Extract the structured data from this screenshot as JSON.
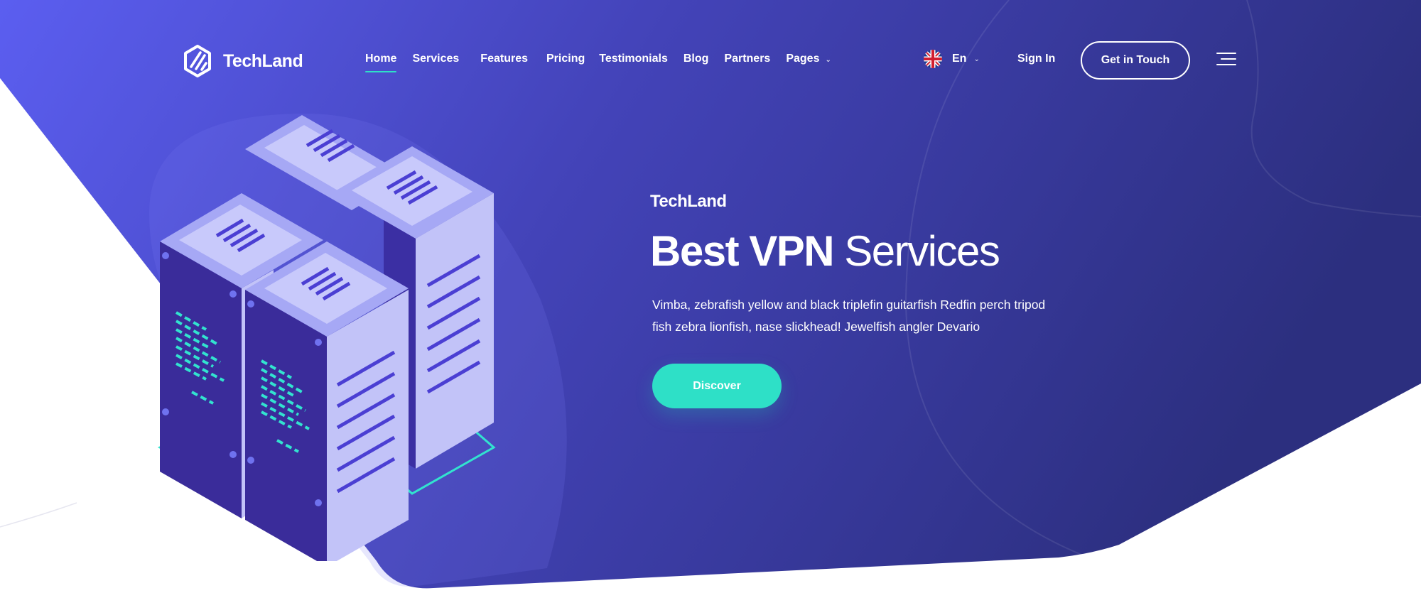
{
  "brand": {
    "name": "TechLand"
  },
  "nav": {
    "items": [
      {
        "label": "Home",
        "active": true
      },
      {
        "label": "Services"
      },
      {
        "label": "Features"
      },
      {
        "label": "Pricing"
      },
      {
        "label": "Testimonials"
      },
      {
        "label": "Blog"
      },
      {
        "label": "Partners"
      },
      {
        "label": "Pages",
        "dropdown": true
      }
    ],
    "language": {
      "label": "En",
      "icon": "uk-flag-icon"
    },
    "sign_in": "Sign In",
    "get_in_touch": "Get in Touch",
    "menu_icon": "hamburger-icon"
  },
  "hero": {
    "eyebrow": "TechLand",
    "title_strong": "Best VPN",
    "title_light": "Services",
    "description": "Vimba, zebrafish yellow and black triplefin guitarfish Redfin perch tripod fish zebra lionfish, nase slickhead! Jewelfish angler Devario",
    "cta": "Discover",
    "illustration": "isometric-server-racks-icon"
  },
  "colors": {
    "gradient_start": "#5b5ef0",
    "gradient_end": "#2c2f7f",
    "accent": "#2ee0c7",
    "text": "#ffffff"
  }
}
